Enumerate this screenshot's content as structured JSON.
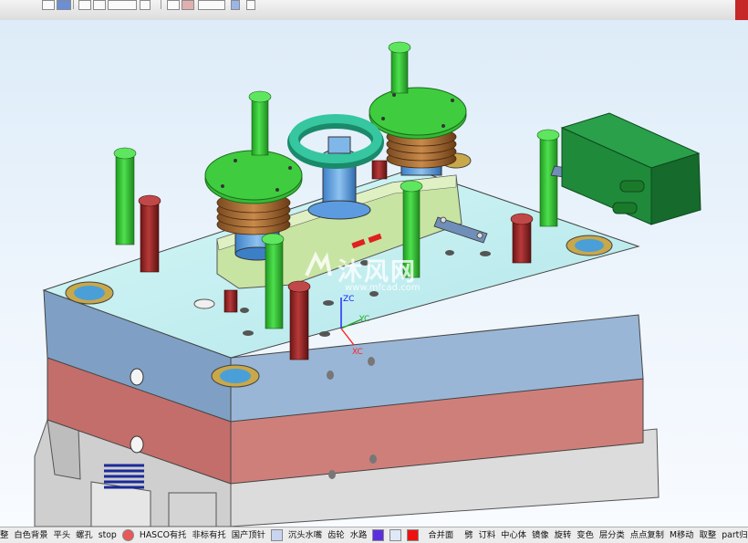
{
  "toolbar": {
    "left_tools": [
      "view-icon",
      "shade-icon",
      "fit-icon",
      "zoom-icon",
      "pan-icon",
      "rotate-icon",
      "select-icon",
      "snap-icon",
      "orient-icon"
    ]
  },
  "viewport": {
    "axes": {
      "zc": "ZC",
      "yc": "YC",
      "xc": "XC"
    },
    "watermark": {
      "brand": "沐风网",
      "url": "www.mfcad.com"
    }
  },
  "colors": {
    "plate_top": "#bfeef0",
    "plate_blue": "#8aaacb",
    "plate_red": "#c97a73",
    "plate_grey": "#d6d6d6",
    "green": "#2fb82f",
    "darkred": "#8a2020",
    "lightgreen": "#c9e5a3",
    "block_green": "#1f8a3a"
  },
  "bottom_toolbar": {
    "left": [
      "整",
      "白色背景",
      "平头",
      "螺孔",
      "stop"
    ],
    "hasco": "HASCO有托",
    "middle": [
      "非标有托",
      "国产顶针"
    ],
    "water": [
      "沉头水嘴",
      "齿轮",
      "水路"
    ],
    "merge": "合并面",
    "right": [
      "劈",
      "订料",
      "中心体",
      "镜像",
      "旋转",
      "变色",
      "层分类",
      "点点复制",
      "M移动",
      "取整",
      "part归零"
    ]
  }
}
